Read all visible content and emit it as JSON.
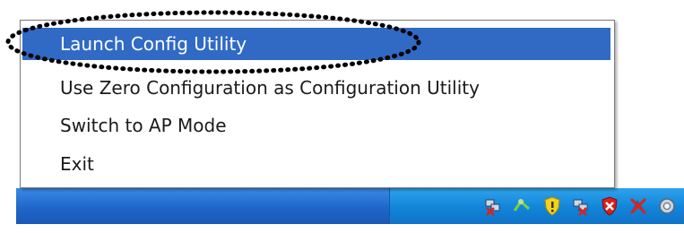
{
  "menu": {
    "items": [
      {
        "label": "Launch Config Utility",
        "selected": true
      },
      {
        "label": "Use Zero Configuration as Configuration Utility",
        "selected": false
      },
      {
        "label": "Switch to AP Mode",
        "selected": false
      },
      {
        "label": "Exit",
        "selected": false
      }
    ]
  },
  "tray": {
    "icons": [
      "network-disconnected-icon",
      "network-activity-icon",
      "security-shield-icon",
      "network-disconnected-icon-2",
      "security-alert-icon",
      "wireless-disconnected-icon",
      "wireless-utility-icon"
    ]
  },
  "colors": {
    "selection": "#316ac5",
    "taskbar": "#1f66c9",
    "tray": "#1284d8"
  }
}
